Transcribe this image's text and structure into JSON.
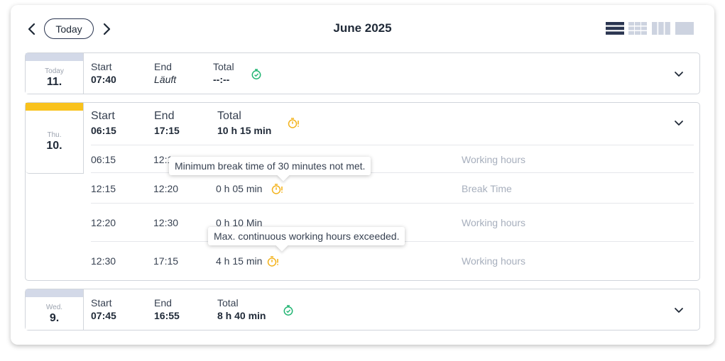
{
  "header": {
    "today_label": "Today",
    "month_title": "June 2025",
    "view_modes": [
      "list-view-icon",
      "month-grid-icon",
      "week-columns-icon",
      "day-block-icon"
    ]
  },
  "colors": {
    "today_band": "#d3d9e8",
    "active_band": "#f9c21c",
    "ok_timer": "#22b573",
    "warn_timer": "#f3b21b",
    "dark": "#2a3550"
  },
  "days": [
    {
      "dow": "Today",
      "date": "11.",
      "start_label": "Start",
      "start": "07:40",
      "end_label": "End",
      "end": "Läuft",
      "total_label": "Total",
      "total": "--:--",
      "status_icon": "timer-ok-icon"
    },
    {
      "dow": "Thu.",
      "date": "10.",
      "start_label": "Start",
      "start": "06:15",
      "end_label": "End",
      "end": "17:15",
      "total_label": "Total",
      "total": "10 h 15 min",
      "status_icon": "timer-warning-icon",
      "entries": [
        {
          "start": "06:15",
          "end": "12:1",
          "duration": "",
          "type": "Working hours"
        },
        {
          "start": "12:15",
          "end": "12:20",
          "duration": "0 h 05 min",
          "type": "Break Time"
        },
        {
          "start": "12:20",
          "end": "12:30",
          "duration": "0 h 10 Min",
          "type": "Working hours"
        },
        {
          "start": "12:30",
          "end": "17:15",
          "duration": "4 h 15 min",
          "type": "Working hours"
        }
      ],
      "tooltips": [
        "Minimum break time of 30 minutes not met.",
        "Max. continuous working hours exceeded."
      ]
    },
    {
      "dow": "Wed.",
      "date": "9.",
      "start_label": "Start",
      "start": "07:45",
      "end_label": "End",
      "end": "16:55",
      "total_label": "Total",
      "total": "8 h 40 min",
      "status_icon": "timer-ok-icon"
    }
  ]
}
